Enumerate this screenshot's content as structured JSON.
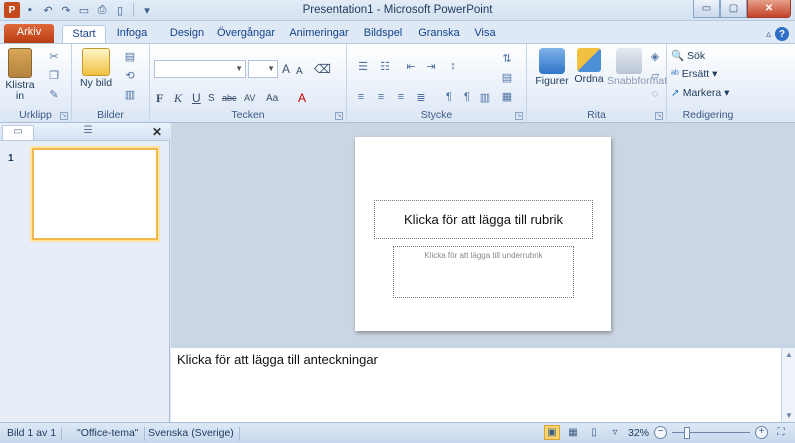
{
  "window": {
    "title": "Presentation1 - Microsoft PowerPoint",
    "app_icon_letter": "P",
    "min_symbol": "▭",
    "max_symbol": "▢",
    "close_symbol": "✕"
  },
  "quick_access": {
    "customize_symbol": "▾"
  },
  "tabs": [
    {
      "label": "Arkiv"
    },
    {
      "label": "Start"
    },
    {
      "label": "Infoga"
    },
    {
      "label": "Design"
    },
    {
      "label": "Övergångar"
    },
    {
      "label": "Animeringar"
    },
    {
      "label": "Bildspel"
    },
    {
      "label": "Granska"
    },
    {
      "label": "Visa"
    }
  ],
  "ribbon": {
    "clipboard": {
      "label": "Urklipp",
      "paste": "Klistra in",
      "paste_arrow": "▾"
    },
    "slides": {
      "label": "Bilder",
      "new_slide": "Ny bild",
      "new_slide_arrow": "▾"
    },
    "font": {
      "label": "Tecken",
      "bold": "F",
      "italic": "K",
      "underline": "U",
      "strike": "S",
      "abc": "abc",
      "spacing": "AV",
      "case": "Aa",
      "grow": "A",
      "shrink": "A",
      "color": "A"
    },
    "paragraph": {
      "label": "Stycke"
    },
    "drawing": {
      "label": "Rita",
      "shapes": "Figurer",
      "arrange": "Ordna",
      "quick_styles": "Snabbformat"
    },
    "editing": {
      "label": "Redigering",
      "find": "Sök",
      "replace": "Ersätt",
      "select": "Markera"
    }
  },
  "left_panel": {
    "slide_number": "1",
    "close_symbol": "✕"
  },
  "slide": {
    "title_placeholder": "Klicka för att lägga till rubrik",
    "subtitle_placeholder": "Klicka för att lägga till underrubrik"
  },
  "notes": {
    "placeholder": "Klicka för att lägga till anteckningar"
  },
  "statusbar": {
    "slide_info": "Bild 1 av 1",
    "theme": "\"Office-tema\"",
    "language": "Svenska (Sverige)",
    "zoom": "32%",
    "zoom_level_fraction": 0.32
  }
}
